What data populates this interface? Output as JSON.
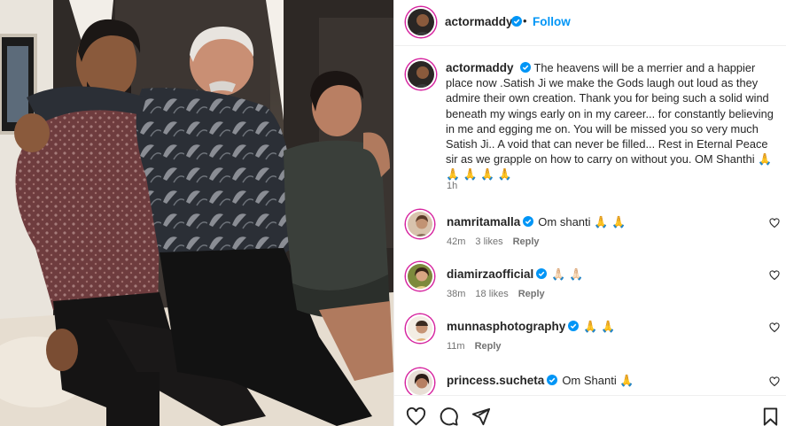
{
  "post": {
    "username": "actormaddy",
    "follow_label": "Follow",
    "separator": "•",
    "more_label": "•••",
    "caption": "The heavens will be a merrier and a happier place now .Satish Ji we make the Gods laugh out loud as they admire their own creation. Thank you for being such a solid wind beneath my wings early on in my career... for constantly believing in me and egging me on. You will be missed you so very much Satish Ji.. A void that can never be filled... Rest in Eternal Peace sir as we grapple on how to carry on without you. OM Shanthi 🙏 🙏 🙏 🙏 🙏",
    "time": "1h"
  },
  "comments": [
    {
      "username": "namritamalla",
      "text": "Om shanti 🙏 🙏",
      "age": "42m",
      "likes": "3 likes",
      "reply": "Reply"
    },
    {
      "username": "diamirzaofficial",
      "text": "🙏🏻 🙏🏻",
      "age": "38m",
      "likes": "18 likes",
      "reply": "Reply"
    },
    {
      "username": "munnasphotography",
      "text": "🙏 🙏",
      "age": "11m",
      "likes": "",
      "reply": "Reply"
    },
    {
      "username": "princess.sucheta",
      "text": "Om Shanti 🙏",
      "age": "",
      "likes": "",
      "reply": ""
    }
  ],
  "icons": {
    "verified": "verified-badge-icon",
    "heart": "heart-icon",
    "comment": "comment-icon",
    "share": "share-icon",
    "save": "save-icon"
  },
  "colors": {
    "accent": "#0095f6",
    "verified": "#0095f6",
    "ring": "#d6249f",
    "muted": "#737373",
    "text": "#262626"
  }
}
